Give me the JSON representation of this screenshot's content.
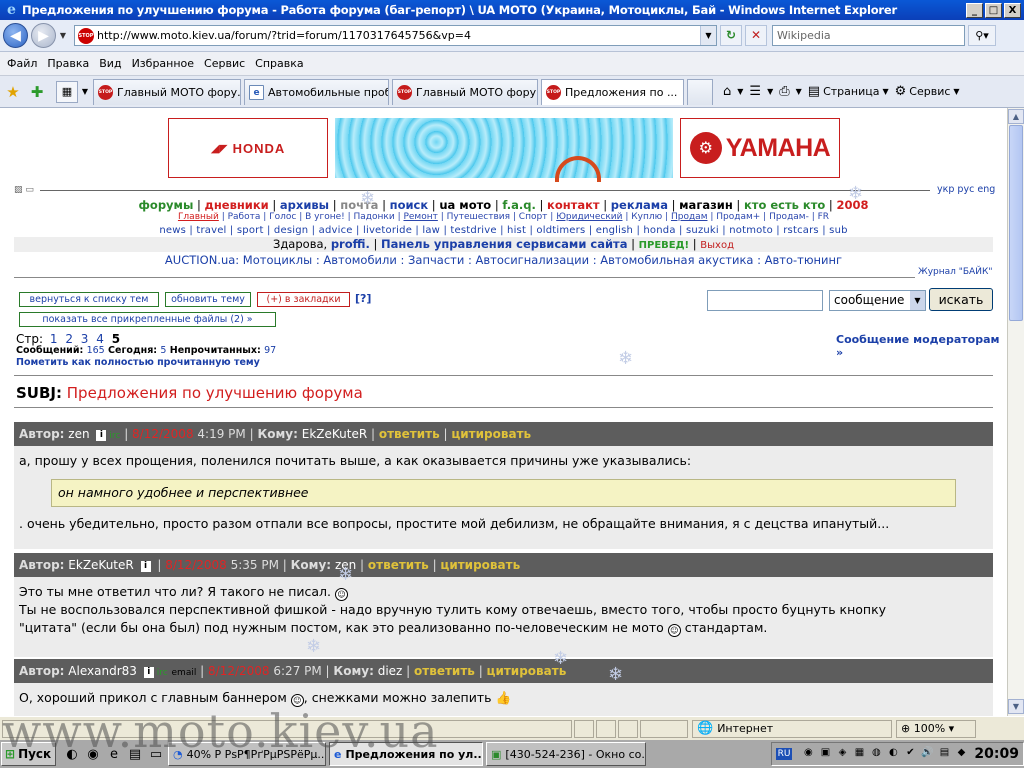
{
  "window": {
    "title": "Предложения по улучшению форума - Работа форума (баг-репорт) \\ UA MOTO (Украина, Мотоциклы, Бай - Windows Internet Explorer",
    "minimize": "_",
    "maximize": "□",
    "close": "X"
  },
  "address": {
    "url": "http://www.moto.kiev.ua/forum/?trid=forum/1170317645756&vp=4",
    "search_placeholder": "Wikipedia",
    "page_icon": "STOP"
  },
  "menu": [
    "Файл",
    "Правка",
    "Вид",
    "Избранное",
    "Сервис",
    "Справка"
  ],
  "tabs": [
    {
      "label": "Главный МОТО фору...",
      "icon": "STOP",
      "active": false
    },
    {
      "label": "Автомобильные проб...",
      "icon": "page",
      "active": false
    },
    {
      "label": "Главный МОТО фору...",
      "icon": "STOP",
      "active": false
    },
    {
      "label": "Предложения по ...",
      "icon": "STOP",
      "active": true
    }
  ],
  "commandbar": {
    "page": "Страница",
    "tools": "Сервис"
  },
  "site": {
    "honda": "HONDA",
    "yamaha": "YAMAHA",
    "langs": {
      "ukr": "укр",
      "rus": "рус",
      "eng": "eng"
    },
    "nav1": [
      "форумы",
      "дневники",
      "архивы",
      "почта",
      "поиск",
      "ua мото",
      "f.a.q.",
      "контакт",
      "реклама",
      "магазин",
      "кто есть кто",
      "2008"
    ],
    "nav2": [
      "Главный",
      "Работа",
      "Голос",
      "В угоне!",
      "Падонки",
      "Ремонт",
      "Путешествия",
      "Спорт",
      "Юридический",
      "Куплю",
      "Продам",
      "Продам+",
      "Продам-",
      "FR"
    ],
    "nav3": [
      "news",
      "travel",
      "sport",
      "design",
      "advice",
      "livetoride",
      "law",
      "testdrive",
      "hist",
      "oldtimers",
      "english",
      "honda",
      "suzuki",
      "notmoto",
      "rstcars",
      "sub"
    ],
    "greeting": "Здарова,",
    "username": "proffi.",
    "panel": "Панель управления сервисами сайта",
    "preved": "ПРЕВЕД!",
    "logout": "Выход",
    "auction": "AUCTION.ua: Мотоциклы : Автомобили : Запчасти : Автосигнализации : Автомобильная акустика : Авто-тюнинг",
    "journal": "Журнал \"БАЙК\""
  },
  "forum": {
    "back_btn": "вернуться к списку тем",
    "refresh_btn": "обновить тему",
    "bookmark_btn": "(+) в закладки",
    "help": "[?]",
    "attachments_btn": "показать все прикрепленные файлы (2) »",
    "search_option": "сообщение",
    "search_btn": "искать",
    "pages_label": "Стр:",
    "pages": [
      "1",
      "2",
      "3",
      "4"
    ],
    "current_page": "5",
    "stats": {
      "messages_label": "Сообщений:",
      "messages": "165",
      "today_label": "Сегодня:",
      "today": "5",
      "unread_label": "Непрочитанных:",
      "unread": "97"
    },
    "mark_read": "Пометить как полностью прочитанную тему",
    "moderators": "Сообщение модераторам »",
    "subj_label": "SUBJ:",
    "subj": "Предложения по улучшению форума"
  },
  "posts": [
    {
      "author_label": "Автор:",
      "author": "zen",
      "extra": "",
      "date": "8/12/2008",
      "time": "4:19 PM",
      "to_label": "Кому:",
      "to": "EkZeKuteR",
      "reply": "ответить",
      "quote_btn": "цитировать",
      "text1": "а, прошу у всех прощения, поленился почитать выше, а как оказывается причины уже указывались:",
      "quote": "он намного удобнее и перспективнее",
      "text2": ". очень убедительно, просто разом отпали все вопросы, простите мой дебилизм, не обращайте внимания, я с децства ипанутый..."
    },
    {
      "author_label": "Автор:",
      "author": "EkZeKuteR",
      "date": "8/12/2008",
      "time": "5:35 PM",
      "to_label": "Кому:",
      "to": "zen",
      "reply": "ответить",
      "quote_btn": "цитировать",
      "line1": "Это ты мне ответил что ли? Я такого не писал.",
      "line2": "Ты не воспользовался перспективной фишкой - надо вручную тулить кому отвечаешь, вместо того, чтобы просто буцнуть кнопку",
      "line3a": "\"цитата\" (если бы она был) под нужным постом, как это реализованно по-человеческим не мото",
      "line3b": "стандартам."
    },
    {
      "author_label": "Автор:",
      "author": "Alexandr83",
      "mail": "email",
      "date": "8/12/2008",
      "time": "6:27 PM",
      "to_label": "Кому:",
      "to": "diez",
      "reply": "ответить",
      "quote_btn": "цитировать",
      "text1": "О, хороший прикол с главным баннером",
      "text2": ", снежками можно залепить"
    }
  ],
  "status": {
    "zone": "Интернет",
    "zoom": "100%"
  },
  "taskbar": {
    "start": "Пуск",
    "tasks": [
      {
        "label": "40% Р РѕР¶РґРµРЅРёРµ...",
        "active": false
      },
      {
        "label": "Предложения по ул...",
        "active": true
      },
      {
        "label": "[430-524-236] - Окно со...",
        "active": false
      }
    ],
    "lang": "RU",
    "clock": "20:09"
  },
  "watermark": "www.moto.kiev.ua",
  "colors": {
    "accent_red": "#d21e1e",
    "link_blue": "#1b3fa8",
    "header_gray": "#5d5d5d",
    "action_gold": "#e0c23a"
  }
}
